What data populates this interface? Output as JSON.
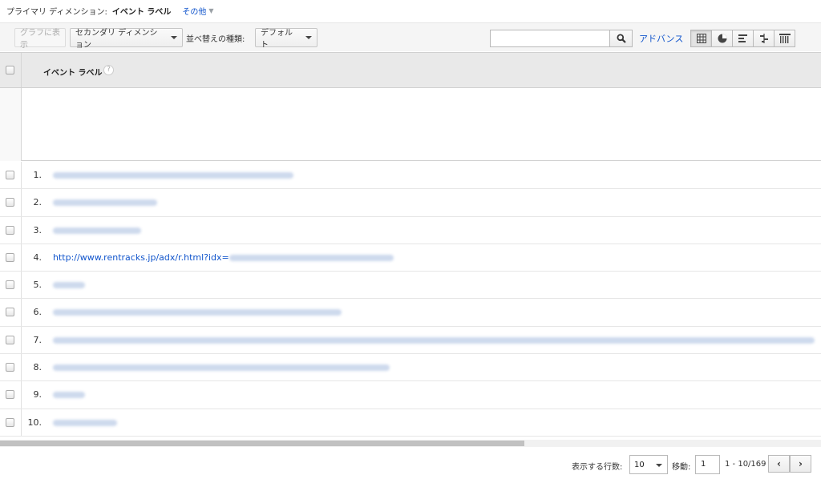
{
  "dimension_bar": {
    "label": "プライマリ ディメンション:",
    "current": "イベント ラベル",
    "other": "その他"
  },
  "toolbar": {
    "plot_button": "グラフに表示",
    "secondary_dimension": "セカンダリ ディメンション",
    "sort_label": "並べ替えの種類:",
    "sort_value": "デフォルト",
    "search_value": "",
    "advanced": "アドバンス"
  },
  "table": {
    "header": "イベント ラベル",
    "help": "?",
    "rows": [
      {
        "index": "1.",
        "url": "http://www.land.mlit.go.jp/webland/servlet/MainServlet",
        "blurred": true
      },
      {
        "index": "2.",
        "url": "http://www.chikamap.jp/",
        "blurred": true
      },
      {
        "index": "3.",
        "url": "http://usedrbank.jp",
        "blurred": true
      },
      {
        "index": "4.",
        "url": "http://www.rentracks.jp/adx/r.html?idx=",
        "blurred": false
      },
      {
        "index": "5.",
        "url": "(not set)",
        "blurred": true
      },
      {
        "index": "6.",
        "url": "http://www.land.mlit.go.jp/landPrice/AreaSelectServlet?MOD=2&TYP=0",
        "blurred": true
      },
      {
        "index": "7.",
        "url": "http://www.mcs.or.jp/img/sound_mapfeedespatch/espatch_count.pdf&search=%E5%8F%8A%E7%8D%86%E5%8F%96%E5%BC%95%E6%A5%AD%E7%95%8C%E5%9B%A3%E4%BD%93",
        "blurred": true
      },
      {
        "index": "8.",
        "url": "http://www.rentracks.jp/adx/r.html?idx=0.3692.94635.750.1335&dna=18162",
        "blurred": true
      },
      {
        "index": "9.",
        "url": "(not set)",
        "blurred": true
      },
      {
        "index": "10.",
        "url": "(not set)",
        "blurred": true
      }
    ]
  },
  "pagination": {
    "rows_label": "表示する行数:",
    "rows_value": "10",
    "goto_label": "移動:",
    "goto_value": "1",
    "range": "1 - 10/169",
    "prev": "‹",
    "next": "›"
  }
}
